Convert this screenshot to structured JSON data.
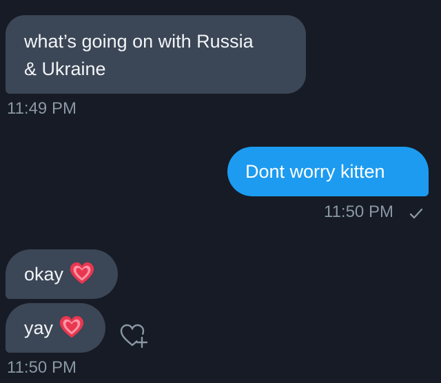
{
  "messages": [
    {
      "id": "msg1",
      "direction": "incoming",
      "text": "what’s going on with Russia\n& Ukraine"
    },
    {
      "id": "msg2",
      "direction": "outgoing",
      "text": "Dont worry kitten"
    },
    {
      "id": "msg3",
      "direction": "incoming",
      "text": "okay",
      "emoji": "heart-icon"
    },
    {
      "id": "msg4",
      "direction": "incoming",
      "text": "yay",
      "emoji": "heart-icon"
    }
  ],
  "timestamps": {
    "first": "11:49 PM",
    "second": "11:50 PM",
    "third": "11:50 PM"
  },
  "icons": {
    "read_receipt": "check-icon",
    "add_reaction": "add-reaction-icon"
  },
  "colors": {
    "background": "#161b25",
    "incoming_bubble": "#3b4656",
    "outgoing_bubble": "#1d9bf0",
    "timestamp": "#8b98a5",
    "heart": "#e8374f"
  }
}
